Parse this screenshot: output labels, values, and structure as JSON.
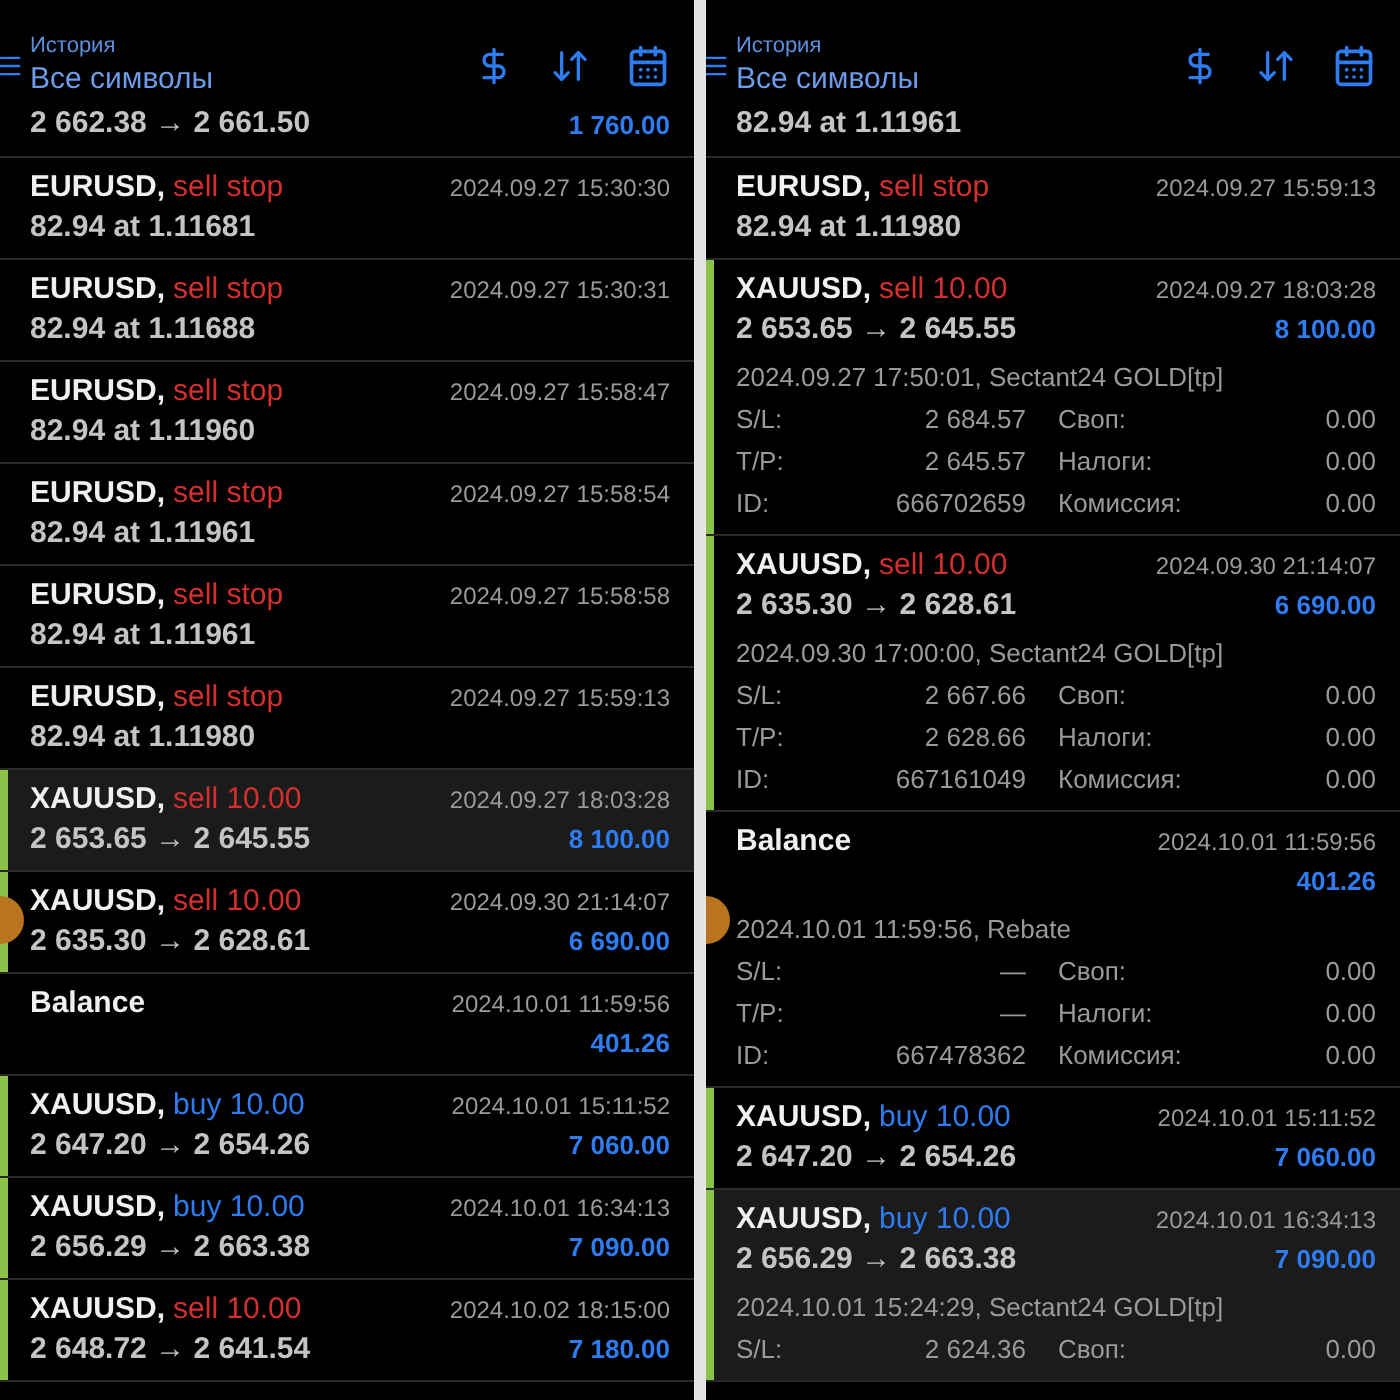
{
  "panels": [
    {
      "header": {
        "subtitle": "История",
        "title": "Все символы"
      },
      "floating_button": true,
      "rows": [
        {
          "kind": "partial",
          "line2": "2 662.38 → 2 661.50",
          "profit": "1 760.00"
        },
        {
          "kind": "order",
          "symbol": "EURUSD,",
          "type": "sell stop",
          "color": "#d32f2f",
          "time": "2024.09.27 15:30:30",
          "line2": "82.94 at 1.11681",
          "highlighted": false
        },
        {
          "kind": "order",
          "symbol": "EURUSD,",
          "type": "sell stop",
          "color": "#d32f2f",
          "time": "2024.09.27 15:30:31",
          "line2": "82.94 at 1.11688",
          "highlighted": false
        },
        {
          "kind": "order",
          "symbol": "EURUSD,",
          "type": "sell stop",
          "color": "#d32f2f",
          "time": "2024.09.27 15:58:47",
          "line2": "82.94 at 1.11960",
          "highlighted": false
        },
        {
          "kind": "order",
          "symbol": "EURUSD,",
          "type": "sell stop",
          "color": "#d32f2f",
          "time": "2024.09.27 15:58:54",
          "line2": "82.94 at 1.11961",
          "highlighted": false
        },
        {
          "kind": "order",
          "symbol": "EURUSD,",
          "type": "sell stop",
          "color": "#d32f2f",
          "time": "2024.09.27 15:58:58",
          "line2": "82.94 at 1.11961",
          "highlighted": false
        },
        {
          "kind": "order",
          "symbol": "EURUSD,",
          "type": "sell stop",
          "color": "#d32f2f",
          "time": "2024.09.27 15:59:13",
          "line2": "82.94 at 1.11980",
          "highlighted": false
        },
        {
          "kind": "deal",
          "symbol": "XAUUSD,",
          "type": "sell 10.00",
          "color": "#d32f2f",
          "time": "2024.09.27 18:03:28",
          "line2": "2 653.65 → 2 645.55",
          "profit": "8 100.00",
          "highlighted": true
        },
        {
          "kind": "deal",
          "symbol": "XAUUSD,",
          "type": "sell 10.00",
          "color": "#d32f2f",
          "time": "2024.09.30 21:14:07",
          "line2": "2 635.30 → 2 628.61",
          "profit": "6 690.00",
          "highlighted": false
        },
        {
          "kind": "balance",
          "symbol": "Balance",
          "time": "2024.10.01 11:59:56",
          "profit": "401.26",
          "highlighted": false
        },
        {
          "kind": "deal",
          "symbol": "XAUUSD,",
          "type": "buy 10.00",
          "color": "#2f7bf0",
          "time": "2024.10.01 15:11:52",
          "line2": "2 647.20 → 2 654.26",
          "profit": "7 060.00",
          "highlighted": false
        },
        {
          "kind": "deal",
          "symbol": "XAUUSD,",
          "type": "buy 10.00",
          "color": "#2f7bf0",
          "time": "2024.10.01 16:34:13",
          "line2": "2 656.29 → 2 663.38",
          "profit": "7 090.00",
          "highlighted": false
        },
        {
          "kind": "deal",
          "symbol": "XAUUSD,",
          "type": "sell 10.00",
          "color": "#d32f2f",
          "time": "2024.10.02 18:15:00",
          "line2": "2 648.72 → 2 641.54",
          "profit": "7 180.00",
          "highlighted": false
        }
      ]
    },
    {
      "header": {
        "subtitle": "История",
        "title": "Все символы"
      },
      "floating_button": true,
      "rows": [
        {
          "kind": "partial",
          "line2": "82.94 at 1.11961"
        },
        {
          "kind": "order",
          "symbol": "EURUSD,",
          "type": "sell stop",
          "color": "#d32f2f",
          "time": "2024.09.27 15:59:13",
          "line2": "82.94 at 1.11980",
          "highlighted": false
        },
        {
          "kind": "deal",
          "symbol": "XAUUSD,",
          "type": "sell 10.00",
          "color": "#d32f2f",
          "time": "2024.09.27 18:03:28",
          "line2": "2 653.65 → 2 645.55",
          "profit": "8 100.00",
          "highlighted": false,
          "details": {
            "comment": "2024.09.27 17:50:01, Sectant24 GOLD[tp]",
            "fields": [
              {
                "label": "S/L:",
                "value": "2 684.57",
                "label2": "Своп:",
                "value2": "0.00"
              },
              {
                "label": "T/P:",
                "value": "2 645.57",
                "label2": "Налоги:",
                "value2": "0.00"
              },
              {
                "label": "ID:",
                "value": "666702659",
                "label2": "Комиссия:",
                "value2": "0.00"
              }
            ]
          }
        },
        {
          "kind": "deal",
          "symbol": "XAUUSD,",
          "type": "sell 10.00",
          "color": "#d32f2f",
          "time": "2024.09.30 21:14:07",
          "line2": "2 635.30 → 2 628.61",
          "profit": "6 690.00",
          "highlighted": false,
          "details": {
            "comment": "2024.09.30 17:00:00, Sectant24 GOLD[tp]",
            "fields": [
              {
                "label": "S/L:",
                "value": "2 667.66",
                "label2": "Своп:",
                "value2": "0.00"
              },
              {
                "label": "T/P:",
                "value": "2 628.66",
                "label2": "Налоги:",
                "value2": "0.00"
              },
              {
                "label": "ID:",
                "value": "667161049",
                "label2": "Комиссия:",
                "value2": "0.00"
              }
            ]
          }
        },
        {
          "kind": "balance",
          "symbol": "Balance",
          "time": "2024.10.01 11:59:56",
          "profit": "401.26",
          "highlighted": false,
          "details": {
            "comment": "2024.10.01 11:59:56, Rebate",
            "fields": [
              {
                "label": "S/L:",
                "value": "—",
                "label2": "Своп:",
                "value2": "0.00"
              },
              {
                "label": "T/P:",
                "value": "—",
                "label2": "Налоги:",
                "value2": "0.00"
              },
              {
                "label": "ID:",
                "value": "667478362",
                "label2": "Комиссия:",
                "value2": "0.00"
              }
            ]
          }
        },
        {
          "kind": "deal",
          "symbol": "XAUUSD,",
          "type": "buy 10.00",
          "color": "#2f7bf0",
          "time": "2024.10.01 15:11:52",
          "line2": "2 647.20 → 2 654.26",
          "profit": "7 060.00",
          "highlighted": false
        },
        {
          "kind": "deal",
          "symbol": "XAUUSD,",
          "type": "buy 10.00",
          "color": "#2f7bf0",
          "time": "2024.10.01 16:34:13",
          "line2": "2 656.29 → 2 663.38",
          "profit": "7 090.00",
          "highlighted": true,
          "details": {
            "comment": "2024.10.01 15:24:29, Sectant24 GOLD[tp]",
            "fields": [
              {
                "label": "S/L:",
                "value": "2 624.36",
                "label2": "Своп:",
                "value2": "0.00"
              }
            ]
          }
        }
      ]
    }
  ]
}
